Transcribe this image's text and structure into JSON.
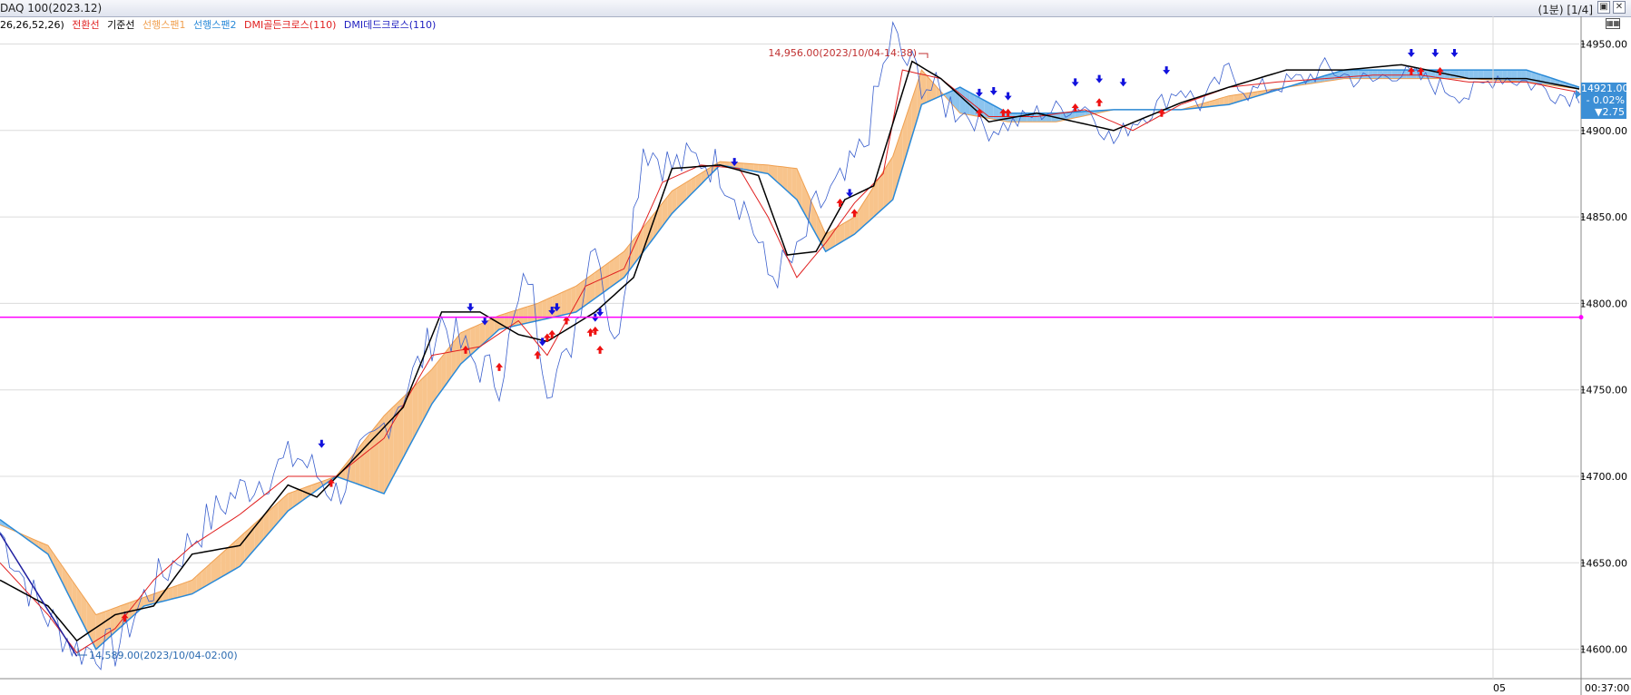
{
  "window": {
    "title": "DAQ 100(2023.12)",
    "page_info": "(1분) [1/4]",
    "restore_icon": "restore-window-icon",
    "close_icon": "close-icon"
  },
  "legend": {
    "params": "26,26,52,26)",
    "conversion": "전환선",
    "base": "기준선",
    "span1": "선행스팬1",
    "span2": "선행스팬2",
    "golden": "DMI골든크로스(110)",
    "dead": "DMI데드크로스(110)"
  },
  "colors": {
    "conversion": "#e02020",
    "base": "#000000",
    "span1": "#f0a050",
    "span2": "#2a8ad8",
    "span1_fill": "#f8c48c",
    "span2_fill": "#8cc4ee",
    "reference": "#ff00ff",
    "up_arrow": "#ee1111",
    "down_arrow": "#1111dd"
  },
  "annotations": {
    "high": "14,956.00(2023/10/04-14:38)",
    "low": "14,589.00(2023/10/04-02:00)"
  },
  "current": {
    "price": "14921.00",
    "change_pct": "- 0.02%",
    "change": "▼2.75"
  },
  "time_axis": {
    "label_day": "05",
    "label_time": "00:37:00"
  },
  "chart_data": {
    "type": "line",
    "title": "DAQ 100(2023.12)",
    "xlabel": "",
    "ylabel": "",
    "ylim": [
      14583,
      14966
    ],
    "yticks": [
      14600,
      14650,
      14700,
      14750,
      14800,
      14850,
      14900,
      14950
    ],
    "ytick_labels": [
      "14600.00",
      "14650.00",
      "14700.00",
      "14750.00",
      "14800.00",
      "14850.00",
      "14900.00",
      "14950.00"
    ],
    "reference_line": 14792,
    "high": 14956,
    "low": 14589,
    "last": 14921,
    "grid": true,
    "x_count": 330,
    "series": [
      {
        "name": "price",
        "x": [
          0,
          8,
          16,
          24,
          30,
          36,
          42,
          48,
          55,
          62,
          70,
          78,
          86,
          92,
          98,
          104,
          110,
          114,
          118,
          124,
          128,
          134,
          140,
          146,
          150,
          156,
          160,
          166,
          170,
          176,
          180,
          186,
          188,
          192,
          196,
          200,
          206,
          212,
          216,
          220,
          226,
          232,
          236,
          240,
          246,
          250,
          256,
          260,
          266,
          272,
          276,
          282,
          286,
          290,
          296,
          300,
          306,
          312,
          318,
          322,
          326,
          329
        ],
        "y": [
          14668,
          14625,
          14600,
          14600,
          14630,
          14650,
          14670,
          14688,
          14700,
          14712,
          14690,
          14720,
          14758,
          14790,
          14768,
          14756,
          14818,
          14756,
          14765,
          14843,
          14772,
          14892,
          14879,
          14884,
          14878,
          14852,
          14816,
          14825,
          14855,
          14870,
          14892,
          14956,
          14942,
          14930,
          14918,
          14912,
          14900,
          14905,
          14910,
          14912,
          14915,
          14893,
          14905,
          14912,
          14925,
          14915,
          14935,
          14922,
          14926,
          14930,
          14936,
          14930,
          14928,
          14934,
          14930,
          14925,
          14920,
          14932,
          14928,
          14924,
          14920,
          14921
        ]
      },
      {
        "name": "전환선",
        "x": [
          0,
          10,
          16,
          24,
          32,
          40,
          50,
          60,
          70,
          80,
          90,
          100,
          108,
          114,
          122,
          130,
          138,
          146,
          154,
          160,
          166,
          172,
          178,
          184,
          188,
          196,
          206,
          216,
          226,
          236,
          246,
          256,
          266,
          276,
          286,
          296,
          306,
          318,
          329
        ],
        "y": [
          14650,
          14620,
          14598,
          14612,
          14640,
          14660,
          14678,
          14700,
          14700,
          14722,
          14770,
          14775,
          14790,
          14770,
          14810,
          14820,
          14870,
          14880,
          14878,
          14850,
          14815,
          14835,
          14858,
          14875,
          14935,
          14930,
          14908,
          14908,
          14912,
          14900,
          14915,
          14925,
          14928,
          14930,
          14932,
          14932,
          14928,
          14928,
          14922
        ]
      },
      {
        "name": "기준선",
        "x": [
          0,
          10,
          16,
          24,
          32,
          40,
          50,
          60,
          66,
          72,
          84,
          92,
          100,
          108,
          114,
          124,
          132,
          140,
          150,
          158,
          164,
          170,
          176,
          182,
          190,
          196,
          206,
          216,
          232,
          246,
          256,
          268,
          280,
          292,
          306,
          318,
          329
        ],
        "y": [
          14640,
          14625,
          14605,
          14620,
          14625,
          14655,
          14660,
          14695,
          14688,
          14705,
          14740,
          14795,
          14795,
          14782,
          14778,
          14795,
          14815,
          14878,
          14880,
          14874,
          14828,
          14830,
          14860,
          14868,
          14940,
          14930,
          14905,
          14910,
          14900,
          14916,
          14925,
          14935,
          14935,
          14938,
          14930,
          14930,
          14924
        ]
      },
      {
        "name": "선행스팬1",
        "x": [
          0,
          10,
          20,
          30,
          40,
          50,
          60,
          70,
          80,
          90,
          96,
          104,
          112,
          120,
          130,
          140,
          150,
          160,
          166,
          172,
          178,
          186,
          192,
          200,
          210,
          220,
          232,
          246,
          256,
          268,
          280,
          292,
          306,
          318,
          329
        ],
        "y": [
          14672,
          14660,
          14620,
          14630,
          14640,
          14665,
          14690,
          14700,
          14735,
          14762,
          14783,
          14793,
          14800,
          14810,
          14830,
          14865,
          14882,
          14880,
          14878,
          14840,
          14850,
          14885,
          14935,
          14910,
          14905,
          14905,
          14912,
          14912,
          14920,
          14925,
          14930,
          14930,
          14930,
          14928,
          14924
        ]
      },
      {
        "name": "선행스팬2",
        "x": [
          0,
          10,
          20,
          30,
          40,
          50,
          60,
          70,
          80,
          90,
          96,
          104,
          112,
          120,
          130,
          140,
          150,
          160,
          166,
          172,
          178,
          186,
          192,
          200,
          210,
          220,
          232,
          246,
          256,
          268,
          280,
          292,
          306,
          318,
          329
        ],
        "y": [
          14675,
          14655,
          14600,
          14625,
          14632,
          14648,
          14680,
          14700,
          14690,
          14742,
          14765,
          14785,
          14790,
          14795,
          14815,
          14852,
          14880,
          14875,
          14860,
          14830,
          14840,
          14860,
          14915,
          14925,
          14910,
          14910,
          14912,
          14912,
          14915,
          14925,
          14935,
          14935,
          14935,
          14935,
          14925
        ]
      },
      {
        "name": "trend",
        "x": [
          0,
          16
        ],
        "y": [
          14667,
          14596
        ]
      }
    ],
    "signals_up": [
      {
        "x": 26,
        "y": 14618
      },
      {
        "x": 69,
        "y": 14696
      },
      {
        "x": 97,
        "y": 14773
      },
      {
        "x": 104,
        "y": 14763
      },
      {
        "x": 112,
        "y": 14770
      },
      {
        "x": 114,
        "y": 14780
      },
      {
        "x": 115,
        "y": 14782
      },
      {
        "x": 118,
        "y": 14790
      },
      {
        "x": 123,
        "y": 14783
      },
      {
        "x": 124,
        "y": 14784
      },
      {
        "x": 125,
        "y": 14773
      },
      {
        "x": 175,
        "y": 14858
      },
      {
        "x": 178,
        "y": 14852
      },
      {
        "x": 204,
        "y": 14910
      },
      {
        "x": 209,
        "y": 14910
      },
      {
        "x": 210,
        "y": 14910
      },
      {
        "x": 224,
        "y": 14913
      },
      {
        "x": 229,
        "y": 14916
      },
      {
        "x": 242,
        "y": 14910
      },
      {
        "x": 294,
        "y": 14934
      },
      {
        "x": 296,
        "y": 14934
      },
      {
        "x": 300,
        "y": 14934
      }
    ],
    "signals_down": [
      {
        "x": 67,
        "y": 14719
      },
      {
        "x": 98,
        "y": 14798
      },
      {
        "x": 101,
        "y": 14790
      },
      {
        "x": 113,
        "y": 14778
      },
      {
        "x": 115,
        "y": 14796
      },
      {
        "x": 116,
        "y": 14798
      },
      {
        "x": 124,
        "y": 14792
      },
      {
        "x": 125,
        "y": 14795
      },
      {
        "x": 153,
        "y": 14882
      },
      {
        "x": 177,
        "y": 14864
      },
      {
        "x": 204,
        "y": 14922
      },
      {
        "x": 207,
        "y": 14923
      },
      {
        "x": 210,
        "y": 14920
      },
      {
        "x": 224,
        "y": 14928
      },
      {
        "x": 229,
        "y": 14930
      },
      {
        "x": 234,
        "y": 14928
      },
      {
        "x": 243,
        "y": 14935
      },
      {
        "x": 294,
        "y": 14945
      },
      {
        "x": 299,
        "y": 14945
      },
      {
        "x": 303,
        "y": 14945
      }
    ]
  }
}
